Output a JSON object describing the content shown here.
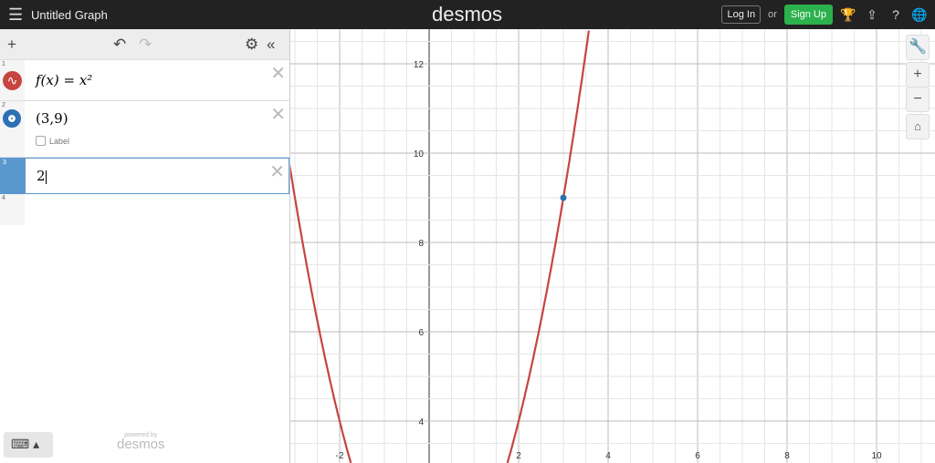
{
  "header": {
    "title": "Untitled Graph",
    "logo": "desmos",
    "login": "Log In",
    "or": "or",
    "signup": "Sign Up"
  },
  "expressions": [
    {
      "num": "1",
      "text": "f(x) = x²",
      "color": "#c74440"
    },
    {
      "num": "2",
      "text": "(3,9)",
      "label": "Label",
      "color": "#2d70b3"
    },
    {
      "num": "3",
      "text": "2"
    },
    {
      "num": "4",
      "text": ""
    }
  ],
  "footer": {
    "powered": "powered by",
    "brand": "desmos"
  },
  "graph": {
    "x_ticks": [
      "-2",
      "2",
      "4",
      "6",
      "8",
      "10"
    ],
    "y_ticks": [
      "4",
      "6",
      "8",
      "10",
      "12"
    ],
    "point": [
      3,
      9
    ],
    "curve": "x^2",
    "curve_color": "#c74440",
    "point_color": "#2d70b3"
  }
}
